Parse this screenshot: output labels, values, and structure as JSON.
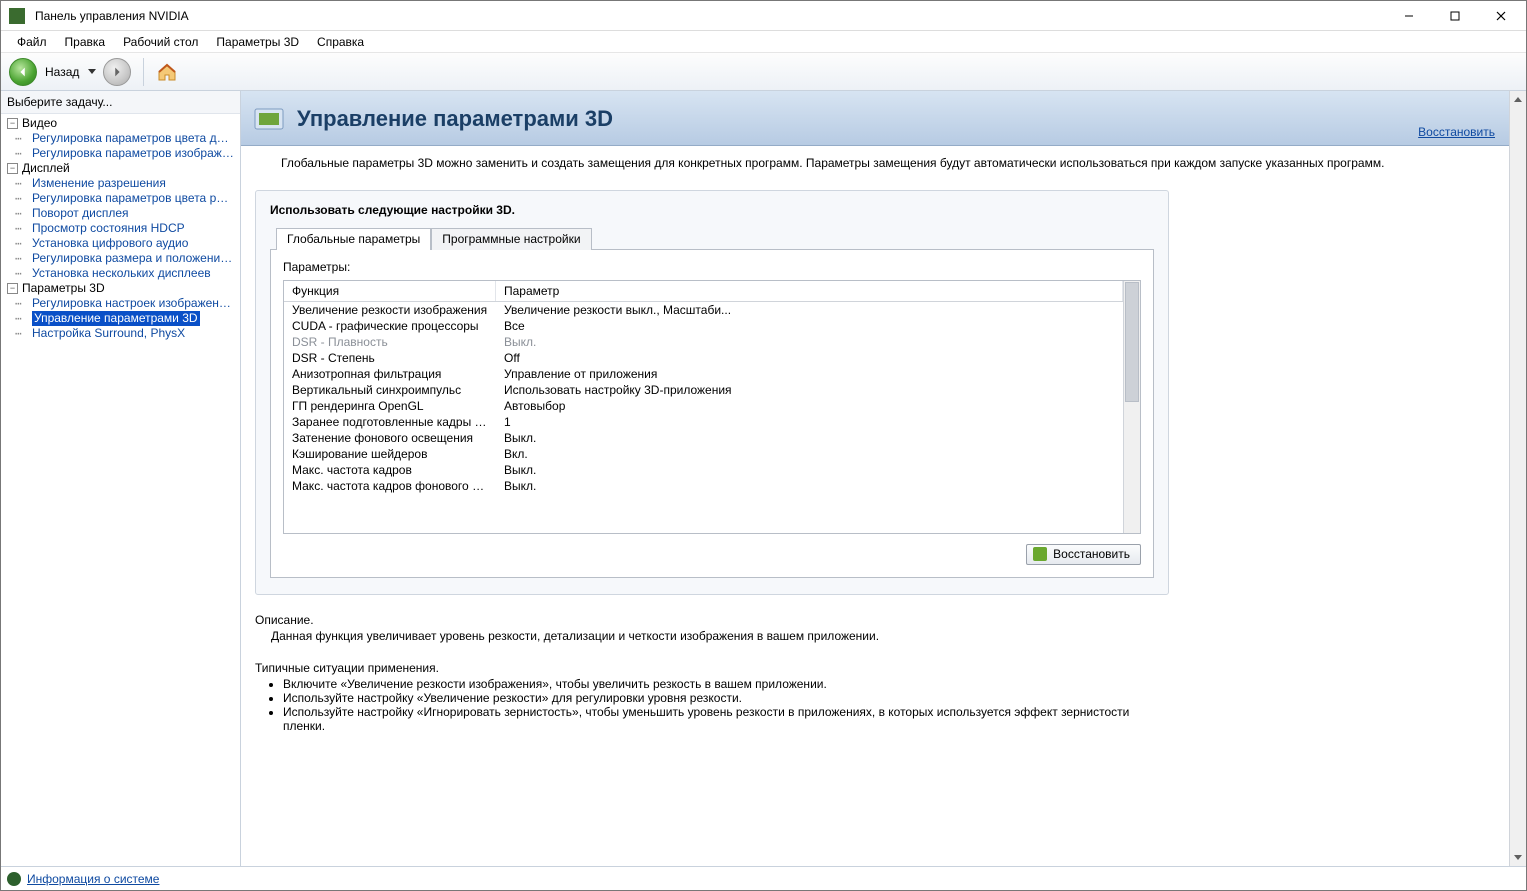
{
  "window": {
    "title": "Панель управления NVIDIA"
  },
  "menu": {
    "file": "Файл",
    "edit": "Правка",
    "desktop": "Рабочий стол",
    "params3d": "Параметры 3D",
    "help": "Справка"
  },
  "toolbar": {
    "back": "Назад"
  },
  "sidebar": {
    "header": "Выберите задачу...",
    "groups": [
      {
        "label": "Видео",
        "items": [
          "Регулировка параметров цвета для вид",
          "Регулировка параметров изображения д"
        ]
      },
      {
        "label": "Дисплей",
        "items": [
          "Изменение разрешения",
          "Регулировка параметров цвета рабочег",
          "Поворот дисплея",
          "Просмотр состояния HDCP",
          "Установка цифрового аудио",
          "Регулировка размера и положения рабо",
          "Установка нескольких дисплеев"
        ]
      },
      {
        "label": "Параметры 3D",
        "items": [
          "Регулировка настроек изображения с пр",
          "Управление параметрами 3D",
          "Настройка Surround, PhysX"
        ]
      }
    ],
    "selected": "Управление параметрами 3D"
  },
  "page": {
    "title": "Управление параметрами 3D",
    "restore": "Восстановить",
    "desc": "Глобальные параметры 3D можно заменить и создать замещения для конкретных программ. Параметры замещения будут автоматически использоваться при каждом запуске указанных программ.",
    "settings_title": "Использовать следующие настройки 3D.",
    "tabs": {
      "global": "Глобальные параметры",
      "program": "Программные настройки"
    },
    "params_label": "Параметры:",
    "grid_header": {
      "func": "Функция",
      "param": "Параметр"
    },
    "rows": [
      {
        "f": "Увеличение резкости изображения",
        "p": "Увеличение резкости выкл., Масштаби..."
      },
      {
        "f": "CUDA - графические процессоры",
        "p": "Все"
      },
      {
        "f": "DSR - Плавность",
        "p": "Выкл.",
        "disabled": true
      },
      {
        "f": "DSR - Степень",
        "p": "Off"
      },
      {
        "f": "Анизотропная фильтрация",
        "p": "Управление от приложения"
      },
      {
        "f": "Вертикальный синхроимпульс",
        "p": "Использовать настройку 3D-приложения"
      },
      {
        "f": "ГП рендеринга OpenGL",
        "p": "Автовыбор"
      },
      {
        "f": "Заранее подготовленные кадры вирту...",
        "p": "1"
      },
      {
        "f": "Затенение фонового освещения",
        "p": "Выкл."
      },
      {
        "f": "Кэширование шейдеров",
        "p": "Вкл."
      },
      {
        "f": "Макс. частота кадров",
        "p": "Выкл."
      },
      {
        "f": "Макс. частота кадров фонового прило...",
        "p": "Выкл."
      }
    ],
    "restore_btn": "Восстановить",
    "description": {
      "head": "Описание.",
      "text": "Данная функция увеличивает уровень резкости, детализации и четкости изображения в вашем приложении."
    },
    "usage": {
      "head": "Типичные ситуации применения.",
      "items": [
        "Включите «Увеличение резкости изображения», чтобы увеличить резкость в вашем приложении.",
        "Используйте настройку «Увеличение резкости» для регулировки уровня резкости.",
        "Используйте настройку «Игнорировать зернистость», чтобы уменьшить уровень резкости в приложениях, в которых используется эффект зернистости пленки."
      ]
    }
  },
  "status": {
    "sysinfo": "Информация о системе"
  }
}
